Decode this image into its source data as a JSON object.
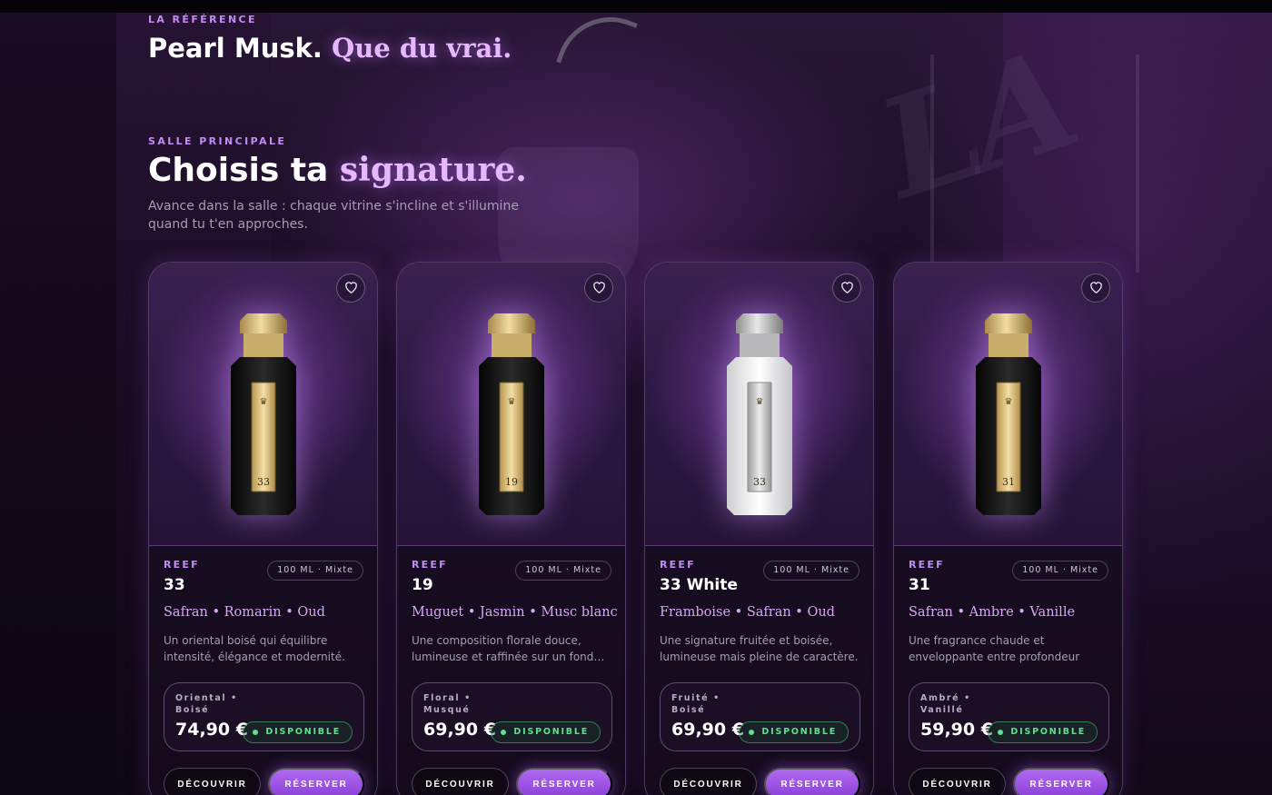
{
  "reference": {
    "kicker": "LA RÉFÉRENCE",
    "title_main": "Pearl Musk.",
    "title_accent": "Que du vrai."
  },
  "section": {
    "kicker": "SALLE PRINCIPALE",
    "title_main": "Choisis ta",
    "title_accent": "signature.",
    "subtitle": "Avance dans la salle : chaque vitrine s'incline et s'illumine quand tu t'en approches."
  },
  "colors": {
    "accent": "#c38cf2",
    "primary_button": "#9b52e3",
    "available": "#5fe08f"
  },
  "icons": {
    "favorite": "heart-icon",
    "status": "dot-icon"
  },
  "products": [
    {
      "brand": "REEF",
      "name": "33",
      "size": "100 ML · Mixte",
      "notes": "Safran • Romarin • Oud",
      "description": "Un oriental boisé qui équilibre intensité, élégance et modernité.",
      "family": "Oriental • Boisé",
      "price": "74,90 €",
      "status": "DISPONIBLE",
      "bottle_number": "33",
      "bottle_style": "black",
      "discover_label": "DÉCOUVRIR",
      "reserve_label": "RÉSERVER"
    },
    {
      "brand": "REEF",
      "name": "19",
      "size": "100 ML · Mixte",
      "notes": "Muguet • Jasmin • Musc blanc",
      "description": "Une composition florale douce, lumineuse et raffinée sur un fond…",
      "family": "Floral • Musqué",
      "price": "69,90 €",
      "status": "DISPONIBLE",
      "bottle_number": "19",
      "bottle_style": "black",
      "discover_label": "DÉCOUVRIR",
      "reserve_label": "RÉSERVER"
    },
    {
      "brand": "REEF",
      "name": "33 White",
      "size": "100 ML · Mixte",
      "notes": "Framboise • Safran • Oud",
      "description": "Une signature fruitée et boisée, lumineuse mais pleine de caractère.",
      "family": "Fruité • Boisé",
      "price": "69,90 €",
      "status": "DISPONIBLE",
      "bottle_number": "33",
      "bottle_style": "white",
      "discover_label": "DÉCOUVRIR",
      "reserve_label": "RÉSERVER"
    },
    {
      "brand": "REEF",
      "name": "31",
      "size": "100 ML · Mixte",
      "notes": "Safran • Ambre • Vanille",
      "description": "Une fragrance chaude et enveloppante entre profondeur ambrée et douceur…",
      "family": "Ambré • Vanillé",
      "price": "59,90 €",
      "status": "DISPONIBLE",
      "bottle_number": "31",
      "bottle_style": "black",
      "discover_label": "DÉCOUVRIR",
      "reserve_label": "RÉSERVER"
    }
  ]
}
